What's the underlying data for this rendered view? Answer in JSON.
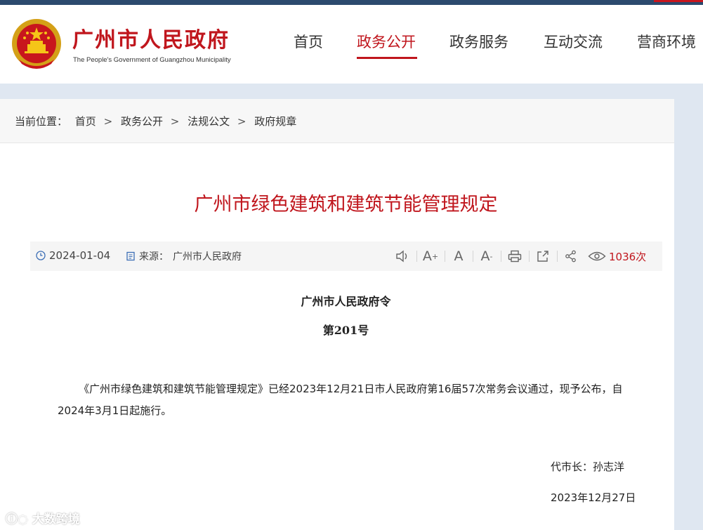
{
  "site": {
    "title": "广州市人民政府",
    "subtitle": "The People's Government of Guangzhou Municipality",
    "brand_color": "#c0161d"
  },
  "nav": {
    "items": [
      {
        "label": "首页",
        "active": false
      },
      {
        "label": "政务公开",
        "active": true
      },
      {
        "label": "政务服务",
        "active": false
      },
      {
        "label": "互动交流",
        "active": false
      },
      {
        "label": "营商环境",
        "active": false
      }
    ]
  },
  "breadcrumb": {
    "prefix": "当前位置：",
    "items": [
      "首页",
      "政务公开",
      "法规公文",
      "政府规章"
    ],
    "separator": ">"
  },
  "article": {
    "title": "广州市绿色建筑和建筑节能管理规定",
    "date": "2024-01-04",
    "source_label": "来源：",
    "source": "广州市人民政府",
    "views": "1036次",
    "tools": [
      "speaker-icon",
      "font-increase-icon",
      "font-reset-icon",
      "font-decrease-icon",
      "print-icon",
      "share-out-icon",
      "share-icon",
      "eye-icon"
    ],
    "decree": "广州市人民政府令",
    "decree_no": "第201号",
    "body": "《广州市绿色建筑和建筑节能管理规定》已经2023年12月21日市人民政府第16届57次常务会议通过，现予公布，自2024年3月1日起施行。",
    "mayor": "代市长：孙志洋",
    "sign_date": "2023年12月27日"
  },
  "watermark": "大数跨境"
}
